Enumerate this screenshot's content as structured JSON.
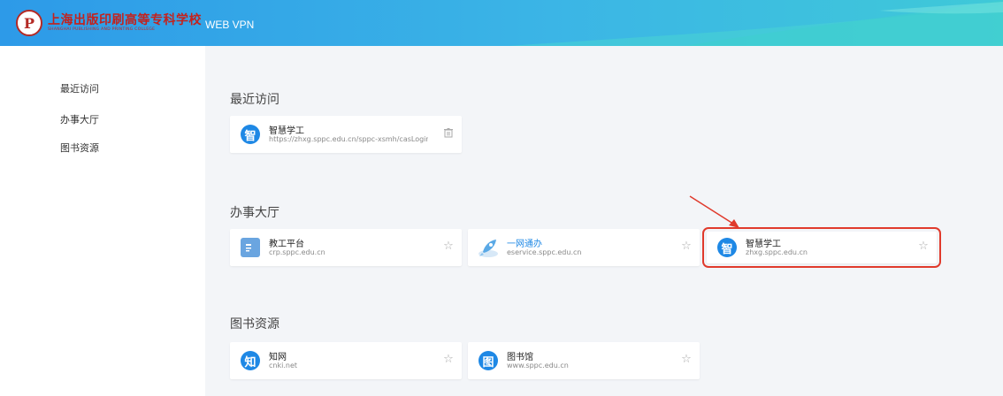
{
  "header": {
    "school_cn": "上海出版印刷高等专科学校",
    "school_en": "SHANGHAI PUBLISHING AND PRINTING COLLEGE",
    "app_title": "WEB VPN",
    "seal_letter": "P"
  },
  "sidebar": {
    "items": [
      {
        "label": "最近访问"
      },
      {
        "label": "办事大厅"
      },
      {
        "label": "图书资源"
      }
    ]
  },
  "sections": {
    "recent": {
      "title": "最近访问",
      "cards": [
        {
          "name": "智慧学工",
          "url": "https://zhxg.sppc.edu.cn/sppc-xsmh/casLogin?ur...",
          "icon": "智",
          "icon_color": "#1e88e5",
          "action": "delete-icon"
        }
      ]
    },
    "hall": {
      "title": "办事大厅",
      "cards": [
        {
          "name": "教工平台",
          "url": "crp.sppc.edu.cn",
          "icon": "document-icon",
          "icon_color": "#6aa5e0",
          "action": "star-icon"
        },
        {
          "name": "一网通办",
          "url": "eservice.sppc.edu.cn",
          "icon": "rocket-icon",
          "icon_color": "#5aa9e6",
          "action": "star-icon"
        },
        {
          "name": "智慧学工",
          "url": "zhxg.sppc.edu.cn",
          "icon": "智",
          "icon_color": "#1e88e5",
          "action": "star-icon"
        }
      ]
    },
    "library": {
      "title": "图书资源",
      "cards": [
        {
          "name": "知网",
          "url": "cnki.net",
          "icon": "知",
          "icon_color": "#1e88e5",
          "action": "star-icon"
        },
        {
          "name": "图书馆",
          "url": "www.sppc.edu.cn",
          "icon": "图",
          "icon_color": "#1e88e5",
          "action": "star-icon"
        }
      ]
    }
  },
  "colors": {
    "header_start": "#2d9ae8",
    "header_end": "#3fc9d8",
    "accent_blue": "#1e88e5",
    "highlight_red": "#e03a2c"
  }
}
